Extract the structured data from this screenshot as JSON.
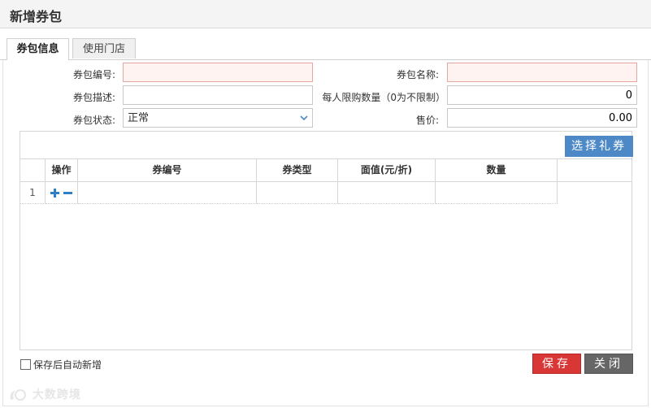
{
  "window": {
    "title": "新增券包"
  },
  "tabs": [
    {
      "label": "券包信息",
      "active": true
    },
    {
      "label": "使用门店",
      "active": false
    }
  ],
  "form": {
    "code_label": "券包编号:",
    "code_value": "",
    "name_label": "券包名称:",
    "name_value": "",
    "desc_label": "券包描述:",
    "desc_value": "",
    "limit_label": "每人限购数量（0为不限制）",
    "limit_value": "0",
    "status_label": "券包状态:",
    "status_value": "正常",
    "price_label": "售价:",
    "price_value": "0.00"
  },
  "grid": {
    "select_button": "选择礼券",
    "headers": [
      "",
      "操作",
      "券编号",
      "券类型",
      "面值(元/折)",
      "数量"
    ],
    "rows": [
      {
        "index": "1",
        "code": "",
        "type": "",
        "value": "",
        "quantity": ""
      }
    ]
  },
  "footer": {
    "auto_add_label": "保存后自动新增",
    "auto_add_checked": false,
    "save_label": "保存",
    "close_label": "关闭"
  },
  "watermark": "大数跨境",
  "colors": {
    "accent_blue": "#4d89c6",
    "save_red": "#d93636",
    "close_gray": "#666666",
    "required_bg": "#fff3f2"
  }
}
